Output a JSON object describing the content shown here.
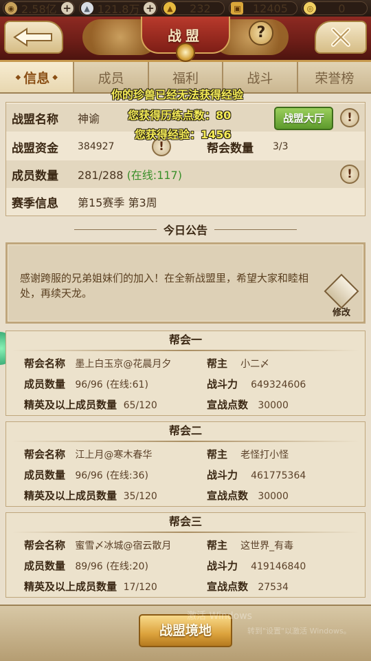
{
  "currencies": [
    {
      "icon": "coin-icon",
      "value": "2.58亿",
      "has_plus": true
    },
    {
      "icon": "silver-ingot-icon",
      "value": "121.8万",
      "has_plus": true
    },
    {
      "icon": "gold-ingot-icon",
      "value": "232",
      "has_plus": false
    },
    {
      "icon": "treasure-chest-icon",
      "value": "12405",
      "has_plus": false
    },
    {
      "icon": "gold-coin-icon",
      "value": "0",
      "has_plus": false
    }
  ],
  "header": {
    "title": "战盟"
  },
  "tabs": [
    {
      "label": "信息",
      "active": true
    },
    {
      "label": "成员",
      "active": false
    },
    {
      "label": "福利",
      "active": false
    },
    {
      "label": "战斗",
      "active": false
    },
    {
      "label": "荣誉榜",
      "active": false
    }
  ],
  "info": {
    "name_label": "战盟名称",
    "name_value": "神谕",
    "hall_button": "战盟大厅",
    "funds_label": "战盟资金",
    "funds_value": "384927",
    "guild_count_label": "帮会数量",
    "guild_count_value": "3/3",
    "members_label": "成员数量",
    "members_value": "281/288",
    "members_online": "(在线:117)",
    "season_label": "赛季信息",
    "season_value": "第15赛季  第3周"
  },
  "announcement": {
    "title": "今日公告",
    "text": "感谢跨服的兄弟姐妹们的加入！在全新战盟里，希望大家和睦相处，再续天龙。",
    "edit_label": "修改"
  },
  "labels": {
    "guild_name": "帮会名称",
    "leader": "帮主",
    "member_count": "成员数量",
    "power": "战斗力",
    "elite_count": "精英及以上成员数量",
    "war_points": "宣战点数"
  },
  "guilds": [
    {
      "title": "帮会一",
      "name": "墨上白玉京@花晨月夕",
      "leader": "小二〆",
      "members": "96/96",
      "online": "(在线:61)",
      "power": "649324606",
      "elite": "65/120",
      "war_points": "30000"
    },
    {
      "title": "帮会二",
      "name": "江上月@寒木春华",
      "leader": "老怪打小怪",
      "members": "96/96",
      "online": "(在线:36)",
      "power": "461775364",
      "elite": "35/120",
      "war_points": "30000"
    },
    {
      "title": "帮会三",
      "name": "蜜雪〆冰城@宿云散月",
      "leader": "这世界_有毒",
      "members": "89/96",
      "online": "(在线:20)",
      "power": "419146840",
      "elite": "17/120",
      "war_points": "27534"
    }
  ],
  "bottom": {
    "realm_button": "战盟境地",
    "watermark": "激活 Windows",
    "watermark_sub": "转到\"设置\"以激活 Windows。"
  },
  "messages": [
    "你的珍兽已经无法获得经验",
    "您获得历练点数：80",
    "您获得经验：1456"
  ],
  "colors": {
    "online_green": "#3a8f2a",
    "header_red": "#8e2a22",
    "message_yellow": "#f5ec58"
  }
}
